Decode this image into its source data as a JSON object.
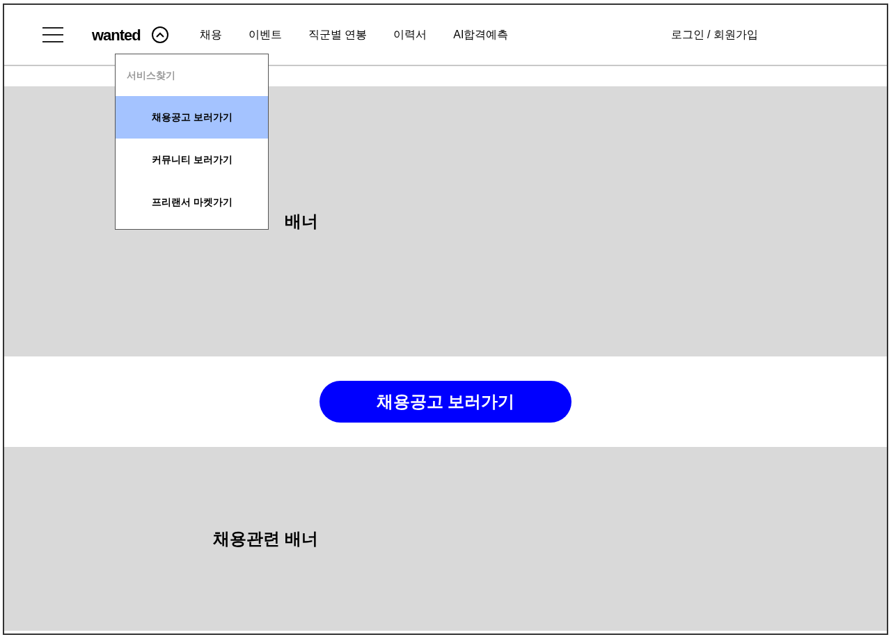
{
  "header": {
    "logo": "wanted",
    "service_menu_expanded": true,
    "nav": [
      "채용",
      "이벤트",
      "직군별 연봉",
      "이력서",
      "AI합격예측"
    ],
    "login": "로그인 / 회원가입"
  },
  "service_menu": {
    "title": "서비스찾기",
    "items": [
      {
        "label": "채용공고 보러가기",
        "selected": true
      },
      {
        "label": "커뮤니티 보러가기",
        "selected": false
      },
      {
        "label": "프리랜서 마켓가기",
        "selected": false
      }
    ]
  },
  "banners": [
    {
      "label": "배너"
    },
    {
      "label": "채용관련 배너"
    }
  ],
  "cta_button": "채용공고 보러가기"
}
